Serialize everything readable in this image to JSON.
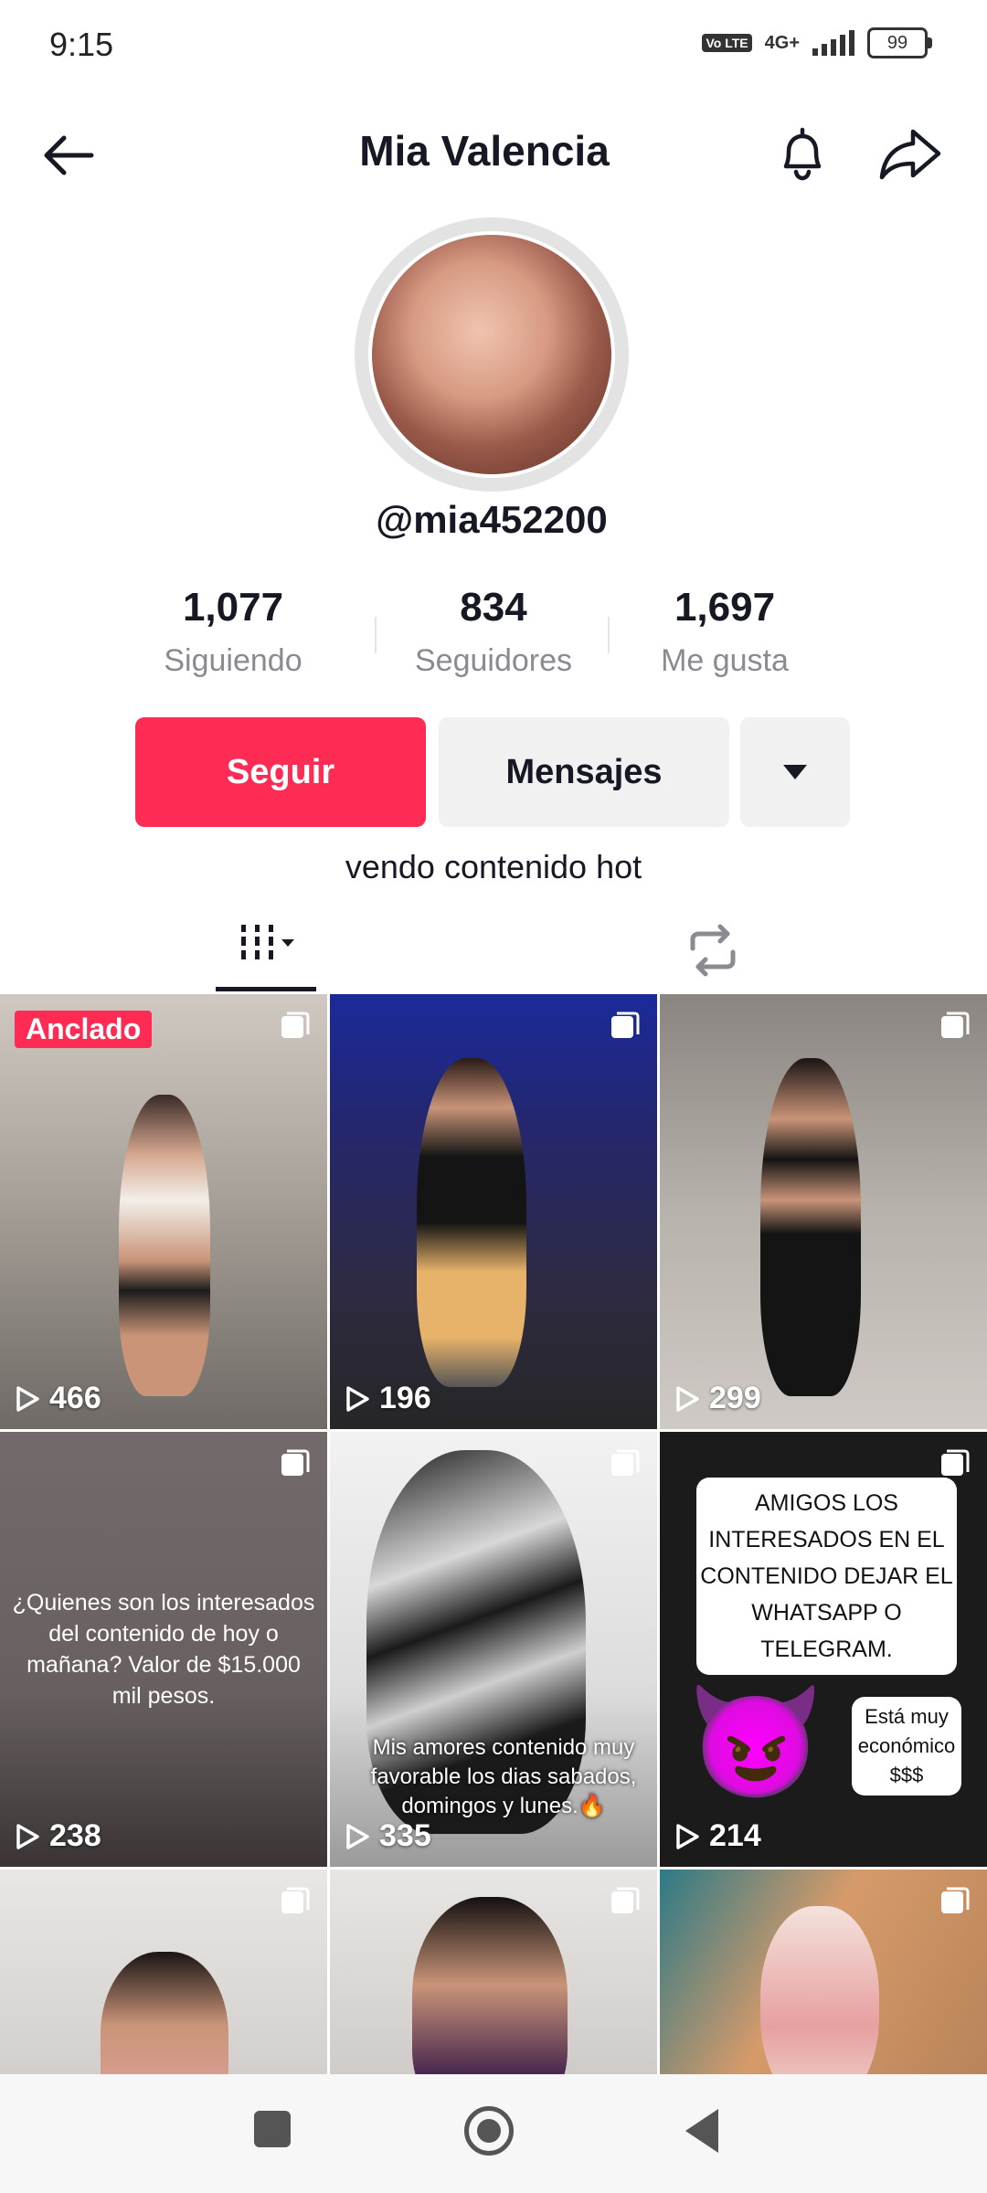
{
  "status": {
    "time": "9:15",
    "volte": "Vo LTE",
    "network": "4G+",
    "battery": "99"
  },
  "header": {
    "title": "Mia Valencia"
  },
  "profile": {
    "username": "@mia452200"
  },
  "stats": [
    {
      "value": "1,077",
      "label": "Siguiendo"
    },
    {
      "value": "834",
      "label": "Seguidores"
    },
    {
      "value": "1,697",
      "label": "Me gusta"
    }
  ],
  "actions": {
    "follow": "Seguir",
    "messages": "Mensajes"
  },
  "bio": "vendo contenido hot",
  "grid": {
    "pinned_label": "Anclado",
    "items": [
      {
        "views": "466"
      },
      {
        "views": "196"
      },
      {
        "views": "299"
      },
      {
        "views": "238",
        "caption": "¿Quienes son los interesados del contenido de hoy o mañana? Valor de $15.000 mil pesos."
      },
      {
        "views": "335",
        "caption": "Mis amores contenido muy favorable los dias sabados, domingos y lunes.🔥"
      },
      {
        "views": "214",
        "caption": "AMIGOS LOS INTERESADOS EN EL CONTENIDO DEJAR EL WHATSAPP O TELEGRAM.",
        "sticker": "Está muy económico $$$",
        "emoji": "😈"
      },
      {
        "views": ""
      },
      {
        "views": ""
      },
      {
        "views": ""
      }
    ]
  },
  "colors": {
    "accent": "#fe2c55",
    "text": "#161823",
    "muted": "#8a8b91",
    "button_bg": "#f1f1f2"
  }
}
